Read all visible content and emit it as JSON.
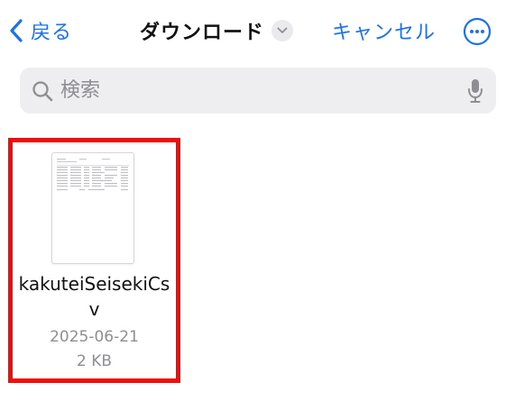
{
  "nav": {
    "back_label": "戻る",
    "title": "ダウンロード",
    "cancel_label": "キャンセル"
  },
  "search": {
    "placeholder": "検索"
  },
  "files": [
    {
      "name": "kakuteiSeisekiCsv",
      "date": "2025-06-21",
      "size": "2 KB"
    }
  ],
  "colors": {
    "accent": "#1a73e8",
    "selection_border": "#f20d0d"
  },
  "icons": {
    "back": "chevron-left-icon",
    "title_menu": "chevron-down-icon",
    "more": "ellipsis-circle-icon",
    "search": "magnifier-icon",
    "mic": "microphone-icon"
  }
}
